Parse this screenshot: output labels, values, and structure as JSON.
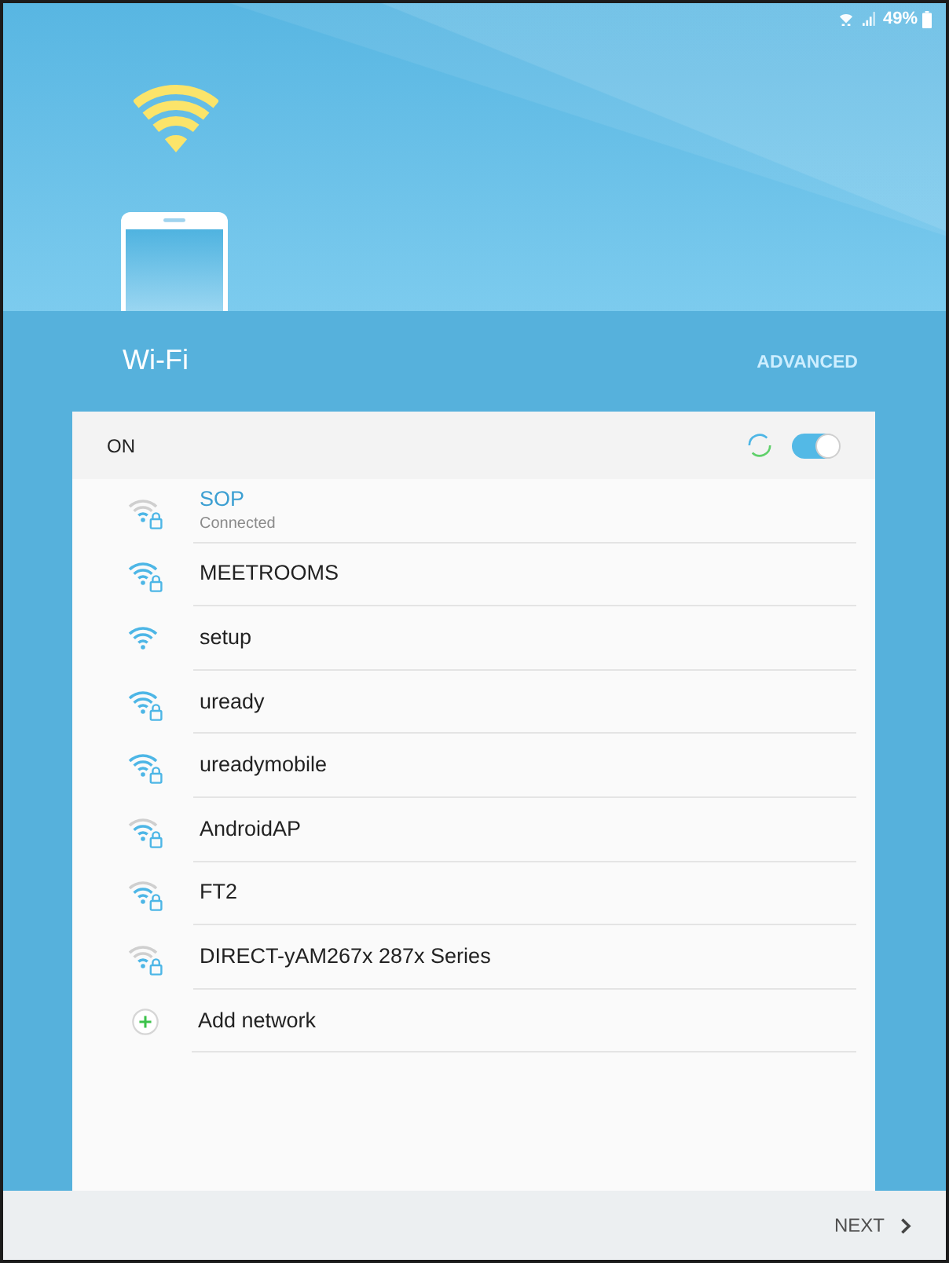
{
  "status_bar": {
    "battery": "49%"
  },
  "header": {
    "title": "Wi-Fi",
    "action": "ADVANCED"
  },
  "wifi": {
    "label": "ON",
    "on": true,
    "scanning": true
  },
  "networks": [
    {
      "name": "SOP",
      "status": "Connected",
      "connected": true,
      "secured": true,
      "kind": "weak"
    },
    {
      "name": "MEETROOMS",
      "connected": false,
      "secured": true,
      "kind": "strong"
    },
    {
      "name": "setup",
      "connected": false,
      "secured": false,
      "kind": "strong"
    },
    {
      "name": "uready",
      "connected": false,
      "secured": true,
      "kind": "strong"
    },
    {
      "name": "ureadymobile",
      "connected": false,
      "secured": true,
      "kind": "strong"
    },
    {
      "name": "AndroidAP",
      "connected": false,
      "secured": true,
      "kind": "good"
    },
    {
      "name": "FT2",
      "connected": false,
      "secured": true,
      "kind": "good"
    },
    {
      "name": "DIRECT-yAM267x 287x Series",
      "connected": false,
      "secured": true,
      "kind": "weak"
    }
  ],
  "add_network": {
    "label": "Add network"
  },
  "footer": {
    "next": "NEXT"
  }
}
